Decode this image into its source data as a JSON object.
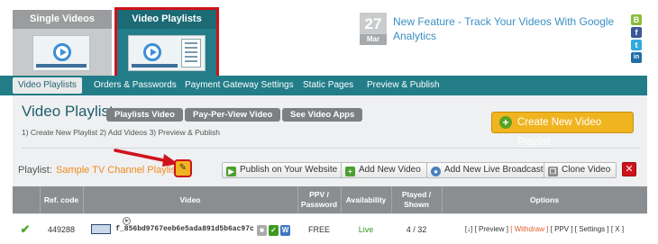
{
  "header": {
    "tabs": [
      {
        "label": "Single Videos"
      },
      {
        "label": "Video Playlists"
      }
    ],
    "news": {
      "day": "27",
      "month": "Mar",
      "link": "New Feature  - Track Your Videos With Google Analytics"
    },
    "social": [
      {
        "icon": "blogger-icon",
        "glyph": "B",
        "color": "#8cbc3c"
      },
      {
        "icon": "facebook-icon",
        "glyph": "f",
        "color": "#3b5998"
      },
      {
        "icon": "twitter-icon",
        "glyph": "t",
        "color": "#33aadd"
      },
      {
        "icon": "linkedin-icon",
        "glyph": "in",
        "color": "#1f6fa8"
      }
    ]
  },
  "nav": {
    "items": [
      {
        "label": "Video Playlists"
      },
      {
        "label": "Orders & Passwords"
      },
      {
        "label": "Payment Gateway Settings"
      },
      {
        "label": "Static Pages"
      },
      {
        "label": "Preview & Publish"
      }
    ]
  },
  "main": {
    "title": "Video Playlists",
    "pills": [
      "Playlists Video",
      "Pay-Per-View Video",
      "See Video Apps"
    ],
    "steps": "1) Create New Playlist  2) Add Videos  3) Preview & Publish",
    "create_button": "Create New Video Playlist",
    "playlist_label": "Playlist:",
    "playlist_name": "Sample TV Channel Playlist",
    "actions": [
      {
        "label": "Publish on Your Website",
        "icon": "publish-icon"
      },
      {
        "label": "Add New Video",
        "icon": "add-video-icon"
      },
      {
        "label": "Add New Live Broadcast",
        "icon": "broadcast-icon"
      },
      {
        "label": "Clone Video",
        "icon": "clone-icon"
      }
    ]
  },
  "table": {
    "columns": [
      "Ref. code",
      "Video",
      "PPV / Password",
      "Availability",
      "Played / Shown",
      "Options"
    ],
    "rows": [
      {
        "ref": "449288",
        "code": "f_856bd9767eeb6e5ada891d5b6ac97c",
        "ppv": "FREE",
        "availability": "Live",
        "played": "4 / 32",
        "options": {
          "move": "[↓]",
          "preview": "[ Preview ]",
          "withdraw": "[ Withdraw ]",
          "ppv": "[ PPV ]",
          "settings": "[ Settings ]",
          "delete": "[ X ]"
        }
      }
    ]
  },
  "colors": {
    "accent": "#227d89",
    "highlight": "#d0121b",
    "orange": "#f08a1d",
    "create_button": "#f0b420"
  }
}
